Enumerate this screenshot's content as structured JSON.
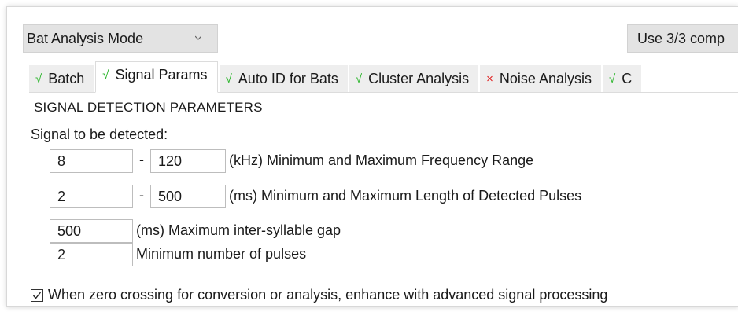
{
  "header": {
    "mode_select_value": "Bat Analysis Mode",
    "use_button_label": "Use 3/3 comp"
  },
  "tabs": [
    {
      "label": "Batch",
      "status": "ok",
      "status_glyph": "√",
      "active": false
    },
    {
      "label": "Signal Params",
      "status": "ok",
      "status_glyph": "√",
      "active": true
    },
    {
      "label": "Auto ID for Bats",
      "status": "ok",
      "status_glyph": "√",
      "active": false
    },
    {
      "label": "Cluster Analysis",
      "status": "ok",
      "status_glyph": "√",
      "active": false
    },
    {
      "label": "Noise Analysis",
      "status": "error",
      "status_glyph": "×",
      "active": false
    },
    {
      "label": "C",
      "status": "ok",
      "status_glyph": "√",
      "active": false
    }
  ],
  "signal_params": {
    "section_title": "SIGNAL DETECTION PARAMETERS",
    "signal_label": "Signal to be detected:",
    "frequency": {
      "min": "8",
      "max": "120",
      "separator": "-",
      "label": "(kHz) Minimum and Maximum Frequency Range"
    },
    "pulse_length": {
      "min": "2",
      "max": "500",
      "separator": "-",
      "label": "(ms) Minimum and Maximum Length of Detected Pulses"
    },
    "gap": {
      "value": "500",
      "label": "(ms) Maximum inter-syllable gap"
    },
    "min_pulses": {
      "value": "2",
      "label": "Minimum number of pulses"
    },
    "enhance": {
      "checked": true,
      "label": "When zero crossing for conversion or analysis, enhance with advanced signal processing"
    }
  },
  "colors": {
    "ok": "#2ab52a",
    "error": "#e02020",
    "control_bg": "#e3e3e3"
  }
}
